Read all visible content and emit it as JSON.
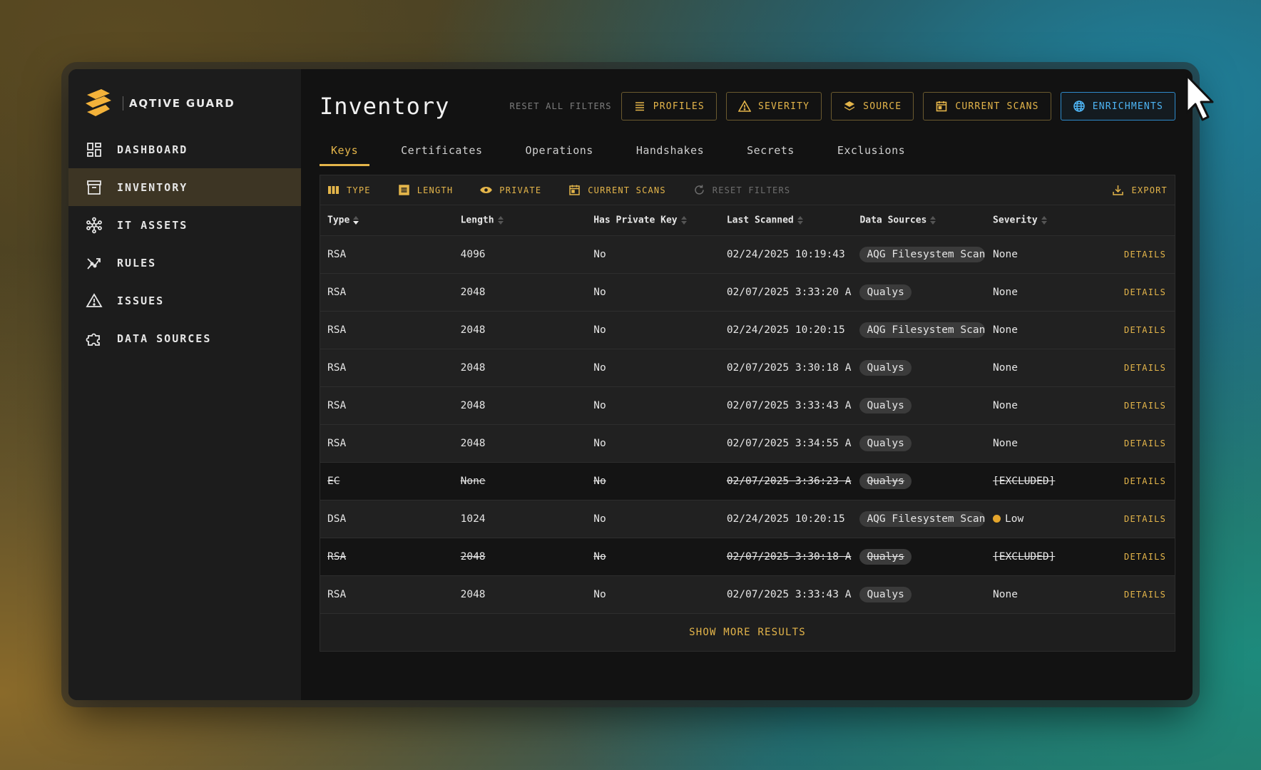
{
  "brand": {
    "name": "AQTIVE GUARD"
  },
  "sidebar": {
    "items": [
      {
        "label": "DASHBOARD",
        "icon": "dashboard-icon",
        "active": false
      },
      {
        "label": "INVENTORY",
        "icon": "inventory-icon",
        "active": true
      },
      {
        "label": "IT ASSETS",
        "icon": "network-icon",
        "active": false
      },
      {
        "label": "RULES",
        "icon": "rules-icon",
        "active": false
      },
      {
        "label": "ISSUES",
        "icon": "warning-icon",
        "active": false
      },
      {
        "label": "DATA SOURCES",
        "icon": "puzzle-icon",
        "active": false
      }
    ]
  },
  "header": {
    "title": "Inventory",
    "reset_all": "RESET ALL FILTERS",
    "filters": [
      {
        "label": "PROFILES",
        "icon": "list-icon"
      },
      {
        "label": "SEVERITY",
        "icon": "warning-icon"
      },
      {
        "label": "SOURCE",
        "icon": "layers-icon"
      },
      {
        "label": "CURRENT SCANS",
        "icon": "calendar-icon"
      },
      {
        "label": "ENRICHMENTS",
        "icon": "globe-icon"
      }
    ]
  },
  "tabs": [
    {
      "label": "Keys",
      "active": true
    },
    {
      "label": "Certificates",
      "active": false
    },
    {
      "label": "Operations",
      "active": false
    },
    {
      "label": "Handshakes",
      "active": false
    },
    {
      "label": "Secrets",
      "active": false
    },
    {
      "label": "Exclusions",
      "active": false
    }
  ],
  "toolbar": {
    "type": "TYPE",
    "length": "LENGTH",
    "private": "PRIVATE",
    "current_scans": "CURRENT SCANS",
    "reset_filters": "RESET FILTERS",
    "export": "EXPORT"
  },
  "table": {
    "columns": [
      "Type",
      "Length",
      "Has Private Key",
      "Last Scanned",
      "Data Sources",
      "Severity"
    ],
    "rows": [
      {
        "type": "RSA",
        "length": "4096",
        "private": "No",
        "scanned": "02/24/2025 10:19:43",
        "source": "AQG Filesystem Scan",
        "severity": "None",
        "excluded": false
      },
      {
        "type": "RSA",
        "length": "2048",
        "private": "No",
        "scanned": "02/07/2025 3:33:20 A",
        "source": "Qualys",
        "severity": "None",
        "excluded": false
      },
      {
        "type": "RSA",
        "length": "2048",
        "private": "No",
        "scanned": "02/24/2025 10:20:15",
        "source": "AQG Filesystem Scan",
        "severity": "None",
        "excluded": false
      },
      {
        "type": "RSA",
        "length": "2048",
        "private": "No",
        "scanned": "02/07/2025 3:30:18 A",
        "source": "Qualys",
        "severity": "None",
        "excluded": false
      },
      {
        "type": "RSA",
        "length": "2048",
        "private": "No",
        "scanned": "02/07/2025 3:33:43 A",
        "source": "Qualys",
        "severity": "None",
        "excluded": false
      },
      {
        "type": "RSA",
        "length": "2048",
        "private": "No",
        "scanned": "02/07/2025 3:34:55 A",
        "source": "Qualys",
        "severity": "None",
        "excluded": false
      },
      {
        "type": "EC",
        "length": "None",
        "private": "No",
        "scanned": "02/07/2025 3:36:23 A",
        "source": "Qualys",
        "severity": "[EXCLUDED]",
        "excluded": true
      },
      {
        "type": "DSA",
        "length": "1024",
        "private": "No",
        "scanned": "02/24/2025 10:20:15",
        "source": "AQG Filesystem Scan",
        "severity": "Low",
        "excluded": false,
        "dot": true
      },
      {
        "type": "RSA",
        "length": "2048",
        "private": "No",
        "scanned": "02/07/2025 3:30:18 A",
        "source": "Qualys",
        "severity": "[EXCLUDED]",
        "excluded": true
      },
      {
        "type": "RSA",
        "length": "2048",
        "private": "No",
        "scanned": "02/07/2025 3:33:43 A",
        "source": "Qualys",
        "severity": "None",
        "excluded": false
      }
    ],
    "details_label": "DETAILS",
    "show_more": "SHOW MORE RESULTS"
  },
  "colors": {
    "accent": "#e4b54a",
    "link_blue": "#4eb5f5",
    "severity_low": "#e4a52c"
  }
}
